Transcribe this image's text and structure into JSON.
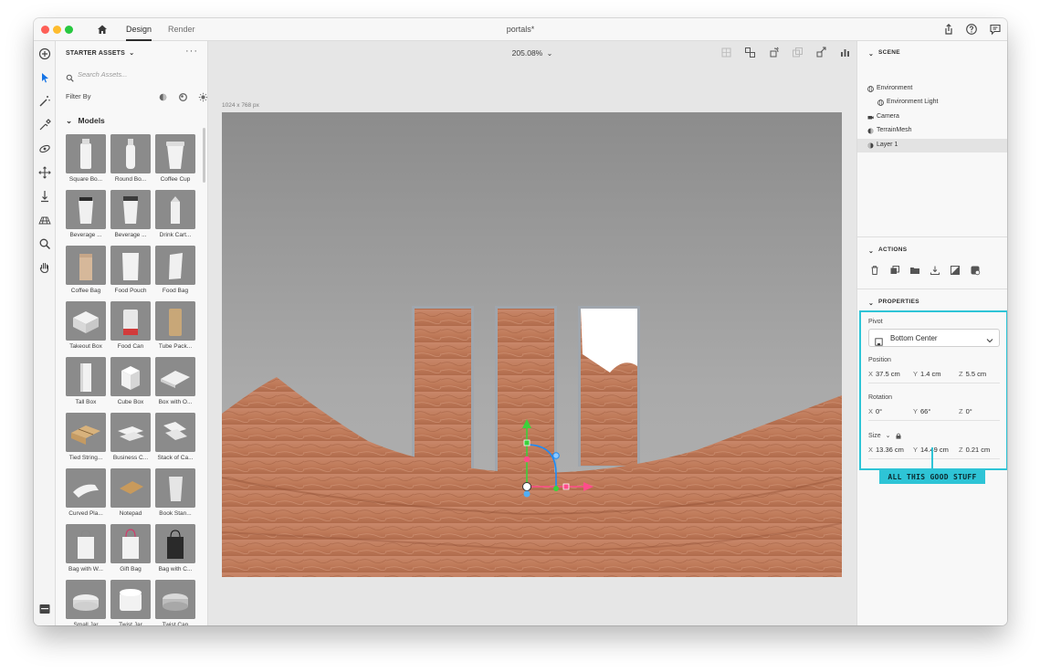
{
  "window": {
    "title": "portals*",
    "tabs": [
      {
        "label": "Design",
        "active": true
      },
      {
        "label": "Render",
        "active": false
      }
    ]
  },
  "toolbar": {
    "tools": [
      "add-icon",
      "select-icon",
      "magic-wand-icon",
      "sampler-icon",
      "orbit-icon",
      "move-icon",
      "drop-to-ground-icon",
      "perspective-icon",
      "zoom-icon",
      "pan-icon"
    ],
    "bottom_tool": "panel-toggle-icon"
  },
  "assets": {
    "header": "STARTER ASSETS",
    "header_chevron": "⌄",
    "more": "···",
    "search_placeholder": "Search Assets...",
    "filter_label": "Filter By",
    "section": "Models",
    "items": [
      {
        "label": "Square Bo...",
        "kind": "bottle-square",
        "color": "#f2f2f2"
      },
      {
        "label": "Round Bo...",
        "kind": "bottle-round",
        "color": "#f2f2f2"
      },
      {
        "label": "Coffee Cup",
        "kind": "cup",
        "color": "#f2f2f2"
      },
      {
        "label": "Beverage ...",
        "kind": "tumbler",
        "color": "#f0f0f0"
      },
      {
        "label": "Beverage ...",
        "kind": "tumbler-lid",
        "color": "#f0f0f0"
      },
      {
        "label": "Drink Cart...",
        "kind": "carton-small",
        "color": "#f0f0f0"
      },
      {
        "label": "Coffee Bag",
        "kind": "bag",
        "color": "#d6b89a"
      },
      {
        "label": "Food Pouch",
        "kind": "pouch",
        "color": "#f2f2f2"
      },
      {
        "label": "Food Bag",
        "kind": "foodbag",
        "color": "#f0f0f0"
      },
      {
        "label": "Takeout Box",
        "kind": "takeout",
        "color": "#f2f2f2"
      },
      {
        "label": "Food Can",
        "kind": "can",
        "color": "#e8e8e8"
      },
      {
        "label": "Tube Pack...",
        "kind": "tube",
        "color": "#c8a778"
      },
      {
        "label": "Tall Box",
        "kind": "tallbox",
        "color": "#f2f2f2"
      },
      {
        "label": "Cube Box",
        "kind": "cubebox",
        "color": "#f2f2f2"
      },
      {
        "label": "Box with O...",
        "kind": "flatbox",
        "color": "#f0f0f0"
      },
      {
        "label": "Tied String...",
        "kind": "parcel",
        "color": "#d8b27c"
      },
      {
        "label": "Business C...",
        "kind": "cards",
        "color": "#f2f2f2"
      },
      {
        "label": "Stack of Ca...",
        "kind": "cards-stack",
        "color": "#f2f2f2"
      },
      {
        "label": "Curved Pla...",
        "kind": "curved",
        "color": "#f2f2f2"
      },
      {
        "label": "Notepad",
        "kind": "notepad",
        "color": "#c89a5c"
      },
      {
        "label": "Book Stan...",
        "kind": "bookstand",
        "color": "#e5e5e5"
      },
      {
        "label": "Bag with W...",
        "kind": "shopping",
        "color": "#f2f2f2"
      },
      {
        "label": "Gift Bag",
        "kind": "giftbag",
        "color": "#f2f2f2"
      },
      {
        "label": "Bag with C...",
        "kind": "blackbag",
        "color": "#2a2a2a"
      },
      {
        "label": "Small Jar",
        "kind": "jar",
        "color": "#eeeeee"
      },
      {
        "label": "Twist Jar",
        "kind": "jar-tall",
        "color": "#f2f2f2"
      },
      {
        "label": "Twist Cap",
        "kind": "cap",
        "color": "#bdbdbd"
      }
    ]
  },
  "canvas": {
    "zoom": "205.08%",
    "dimensions": "1024 x 768 px",
    "top_icons": [
      "frame-icon",
      "group-icon",
      "rotate-icon",
      "duplicate-icon",
      "move-object-icon",
      "chart-icon"
    ]
  },
  "scene": {
    "header": "SCENE",
    "layers": [
      {
        "label": "Environment",
        "icon": "globe-icon",
        "indent": 0,
        "selected": false
      },
      {
        "label": "Environment Light",
        "icon": "globe-icon",
        "indent": 1,
        "selected": false
      },
      {
        "label": "Camera",
        "icon": "camera-icon",
        "indent": 0,
        "selected": false
      },
      {
        "label": "TerrainMesh",
        "icon": "mesh-icon",
        "indent": 0,
        "selected": false
      },
      {
        "label": "Layer 1",
        "icon": "layer-icon",
        "indent": 0,
        "selected": true
      }
    ]
  },
  "actions": {
    "header": "ACTIONS",
    "icons": [
      "trash-icon",
      "duplicate-icon",
      "folder-icon",
      "drop-icon",
      "mask-icon",
      "material-icon"
    ]
  },
  "properties": {
    "header": "PROPERTIES",
    "pivot_label": "Pivot",
    "pivot_value": "Bottom Center",
    "position_label": "Position",
    "position": {
      "x": "37.5 cm",
      "y": "1.4 cm",
      "z": "5.5 cm"
    },
    "rotation_label": "Rotation",
    "rotation": {
      "x": "0°",
      "y": "66°",
      "z": "0°"
    },
    "size_label": "Size",
    "size": {
      "x": "13.36 cm",
      "y": "14.49 cm",
      "z": "0.21 cm"
    },
    "axis": {
      "x": "X",
      "y": "Y",
      "z": "Z"
    }
  },
  "annotation": {
    "text": "ALL THIS GOOD STUFF",
    "color": "#2ec4d6"
  }
}
